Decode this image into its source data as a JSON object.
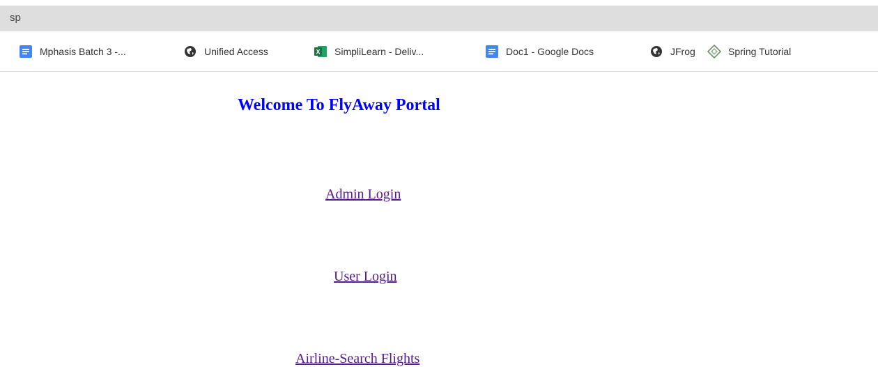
{
  "address_bar": {
    "text": "sp"
  },
  "bookmarks": [
    {
      "label": "Mphasis Batch 3 -...",
      "icon": "google-docs-icon"
    },
    {
      "label": "Unified Access",
      "icon": "globe-icon"
    },
    {
      "label": "SimpliLearn - Deliv...",
      "icon": "excel-icon"
    },
    {
      "label": "Doc1 - Google Docs",
      "icon": "google-docs-icon"
    },
    {
      "label": "JFrog",
      "icon": "globe-icon"
    },
    {
      "label": "Spring Tutorial",
      "icon": "spring-icon"
    }
  ],
  "page": {
    "heading": "Welcome To FlyAway Portal",
    "links": {
      "admin_login": "Admin Login",
      "user_login": "User Login",
      "airline_search": "Airline-Search Flights"
    }
  },
  "colors": {
    "heading": "#0000ff",
    "visited_link": "#551a8b",
    "docs_blue": "#4285f4",
    "excel_green": "#1d6f42",
    "address_bg": "#dedede"
  }
}
